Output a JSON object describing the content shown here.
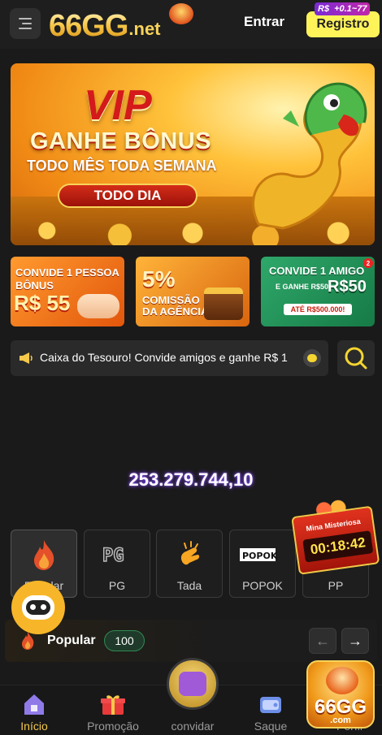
{
  "header": {
    "logo_main": "66GG",
    "logo_sub": ".net",
    "login_label": "Entrar",
    "register_label": "Registro",
    "register_badge_currency": "R$",
    "register_badge_bonus": "+0.1~77"
  },
  "banner": {
    "vip": "VIP",
    "headline": "GANHE BÔNUS",
    "subline": "TODO MÊS TODA SEMANA",
    "button": "TODO DIA"
  },
  "promos": [
    {
      "line1": "CONVIDE 1 PESSOA",
      "line2": "BÔNUS",
      "amount": "R$ 55"
    },
    {
      "percent": "5%",
      "line1": "COMISSÃO",
      "line2": "DA AGÊNCIA"
    },
    {
      "line1": "CONVIDE 1 AMIGO",
      "line2": "E GANHE R$50",
      "amount": "R$50",
      "bar": "ATÉ R$500.000!",
      "badge": "2"
    }
  ],
  "marquee": {
    "text": "Caixa do Tesouro! Convide amigos e ganhe R$ 1"
  },
  "jackpot": {
    "value": "253.279.744,10"
  },
  "game_tabs": [
    {
      "label": "Popular",
      "active": true
    },
    {
      "label": "PG",
      "active": false
    },
    {
      "label": "Tada",
      "active": false
    },
    {
      "label": "POPOK",
      "active": false
    },
    {
      "label": "PP",
      "active": false
    }
  ],
  "popular_section": {
    "title": "Popular",
    "count": "100"
  },
  "mystery_mine": {
    "label": "Mina Misteriosa",
    "timer": "00:18:42"
  },
  "bottom_nav": [
    {
      "label": "Início",
      "active": true
    },
    {
      "label": "Promoção",
      "active": false
    },
    {
      "label": "convidar",
      "active": false
    },
    {
      "label": "Saque",
      "active": false
    },
    {
      "label": "Perfil",
      "active": false
    }
  ],
  "app_logo": {
    "text": "66GG",
    "sub": ".com"
  },
  "colors": {
    "background": "#1a1a1a",
    "accent_yellow": "#fff35a",
    "gold": "#f5c84a",
    "jackpot_glow": "#7b3cff"
  }
}
